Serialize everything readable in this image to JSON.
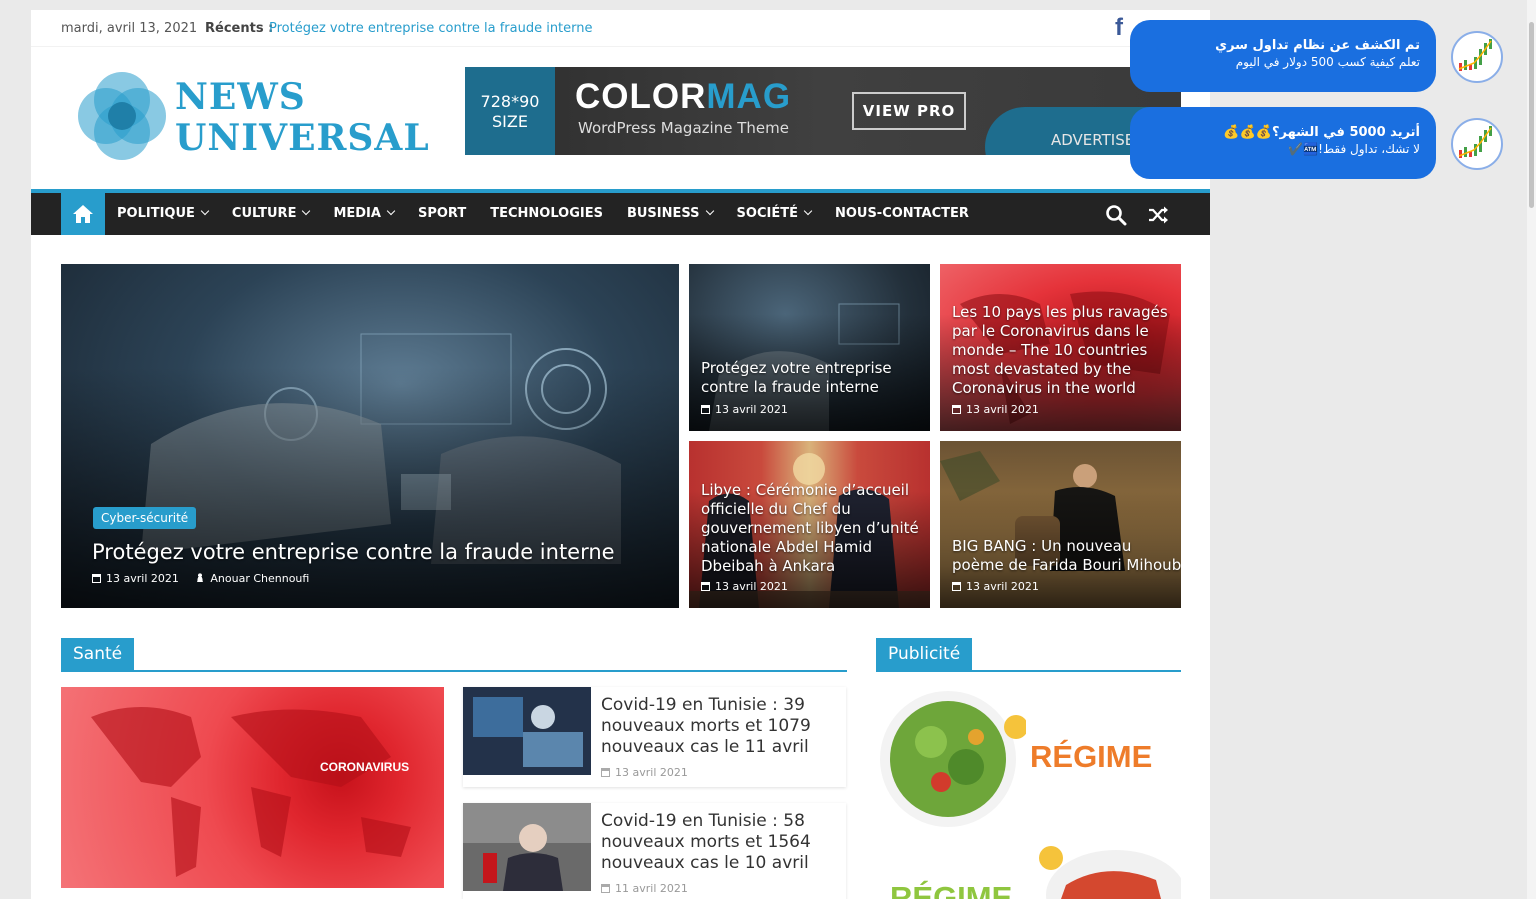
{
  "topbar": {
    "date": "mardi, avril 13, 2021",
    "recent_label": "Récents :",
    "recent_link": "Protégez votre entreprise contre la fraude interne",
    "social_icon": "facebook-icon"
  },
  "header": {
    "logo_line1": "NEWS",
    "logo_line2": "UNIVERSAL",
    "banner": {
      "size_line1": "728*90",
      "size_line2": "SIZE",
      "brand_a": "COLOR",
      "brand_b": "MAG",
      "subtitle": "WordPress Magazine Theme",
      "button": "VIEW PRO",
      "advertise": "ADVERTISE"
    }
  },
  "nav": {
    "home_icon": "home-icon",
    "items": [
      {
        "label": "POLITIQUE",
        "dropdown": true
      },
      {
        "label": "CULTURE",
        "dropdown": true
      },
      {
        "label": "MEDIA",
        "dropdown": true
      },
      {
        "label": "SPORT",
        "dropdown": false
      },
      {
        "label": "TECHNOLOGIES",
        "dropdown": false
      },
      {
        "label": "BUSINESS",
        "dropdown": true
      },
      {
        "label": "SOCIÉTÉ",
        "dropdown": true
      },
      {
        "label": "NOUS-CONTACTER",
        "dropdown": false
      }
    ],
    "search_icon": "search-icon",
    "random_icon": "shuffle-icon"
  },
  "featured": {
    "main": {
      "category": "Cyber-sécurité",
      "title": "Protégez votre entreprise contre la fraude interne",
      "date": "13 avril 2021",
      "author": "Anouar Chennoufi"
    },
    "tiles": [
      {
        "title": "Protégez votre entreprise contre la fraude interne",
        "date": "13 avril 2021"
      },
      {
        "title": "Les 10 pays les plus ravagés par le Coronavirus dans le monde – The 10 countries most devastated by the Coronavirus in the world",
        "date": "13 avril 2021"
      },
      {
        "title": "Libye : Cérémonie d’accueil officielle du Chef du gouvernement libyen d’unité nationale Abdel Hamid Dbeibah à Ankara",
        "date": "13 avril 2021"
      },
      {
        "title": "BIG BANG : Un nouveau poème de Farida Bouri Mihoub",
        "date": "13 avril 2021"
      }
    ]
  },
  "sante": {
    "label": "Santé",
    "big_image_text": "CORONAVIRUS",
    "items": [
      {
        "title": "Covid-19 en Tunisie : 39 nouveaux morts et 1079 nouveaux cas le 11 avril",
        "date": "13 avril 2021"
      },
      {
        "title": "Covid-19 en Tunisie : 58 nouveaux morts et 1564 nouveaux cas le 10 avril",
        "date": "11 avril 2021"
      }
    ]
  },
  "publicite": {
    "label": "Publicité",
    "ad1_text": "RÉGIME",
    "ad2_text": "RÉGIME"
  },
  "notifications": [
    {
      "title": "تم الكشف عن نظام تداول سري",
      "body": "تعلم كيفية كسب 500 دولار في اليوم"
    },
    {
      "title": "أتريد 5000 في الشهر؟💰💰💰",
      "body": "لا تشك، تداول فقط!🏧✔️"
    }
  ]
}
